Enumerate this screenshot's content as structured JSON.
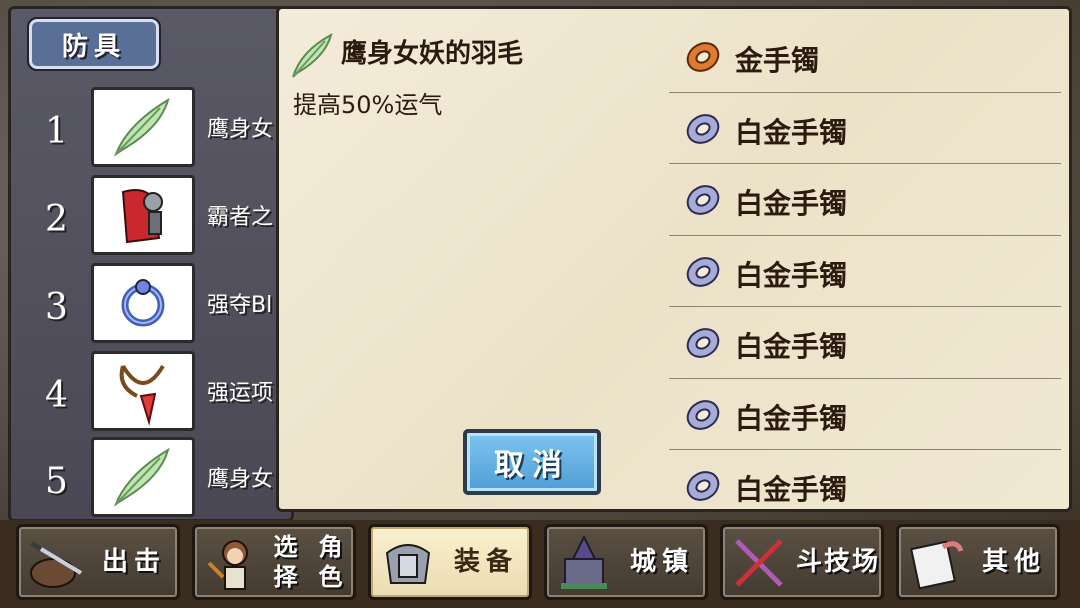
{
  "left": {
    "category": "防具",
    "items": [
      {
        "num": "1",
        "name": "鹰身女",
        "icon": "feather-icon"
      },
      {
        "num": "2",
        "name": "霸者之",
        "icon": "red-cape-icon"
      },
      {
        "num": "3",
        "name": "强夺Bl",
        "icon": "blue-ring-icon"
      },
      {
        "num": "4",
        "name": "强运项",
        "icon": "pendant-icon"
      },
      {
        "num": "5",
        "name": "鹰身女",
        "icon": "feather-icon"
      }
    ]
  },
  "selected": {
    "name": "鹰身女妖的羽毛",
    "description": "提高50%运气",
    "icon": "feather-icon"
  },
  "list": [
    {
      "label": "金手镯",
      "icon": "gold-bracelet-icon"
    },
    {
      "label": "白金手镯",
      "icon": "platinum-bracelet-icon"
    },
    {
      "label": "白金手镯",
      "icon": "platinum-bracelet-icon"
    },
    {
      "label": "白金手镯",
      "icon": "platinum-bracelet-icon"
    },
    {
      "label": "白金手镯",
      "icon": "platinum-bracelet-icon"
    },
    {
      "label": "白金手镯",
      "icon": "platinum-bracelet-icon"
    },
    {
      "label": "白金手镯",
      "icon": "platinum-bracelet-icon"
    }
  ],
  "cancel_label": "取消",
  "nav": [
    {
      "label": "出击",
      "icon": "sword-bag-icon"
    },
    {
      "label": "选择角色",
      "label1": "选择",
      "label2": "角色",
      "icon": "character-icon"
    },
    {
      "label": "装备",
      "icon": "armor-icon",
      "active": true
    },
    {
      "label": "城镇",
      "icon": "castle-icon"
    },
    {
      "label": "斗技场",
      "icon": "crossed-swords-icon"
    },
    {
      "label": "其他",
      "icon": "scroll-icon"
    }
  ],
  "colors": {
    "cancel_button": "#5fb0e3",
    "popup_bg": "#f1e8d2",
    "active_nav": "#f5e9c2"
  }
}
